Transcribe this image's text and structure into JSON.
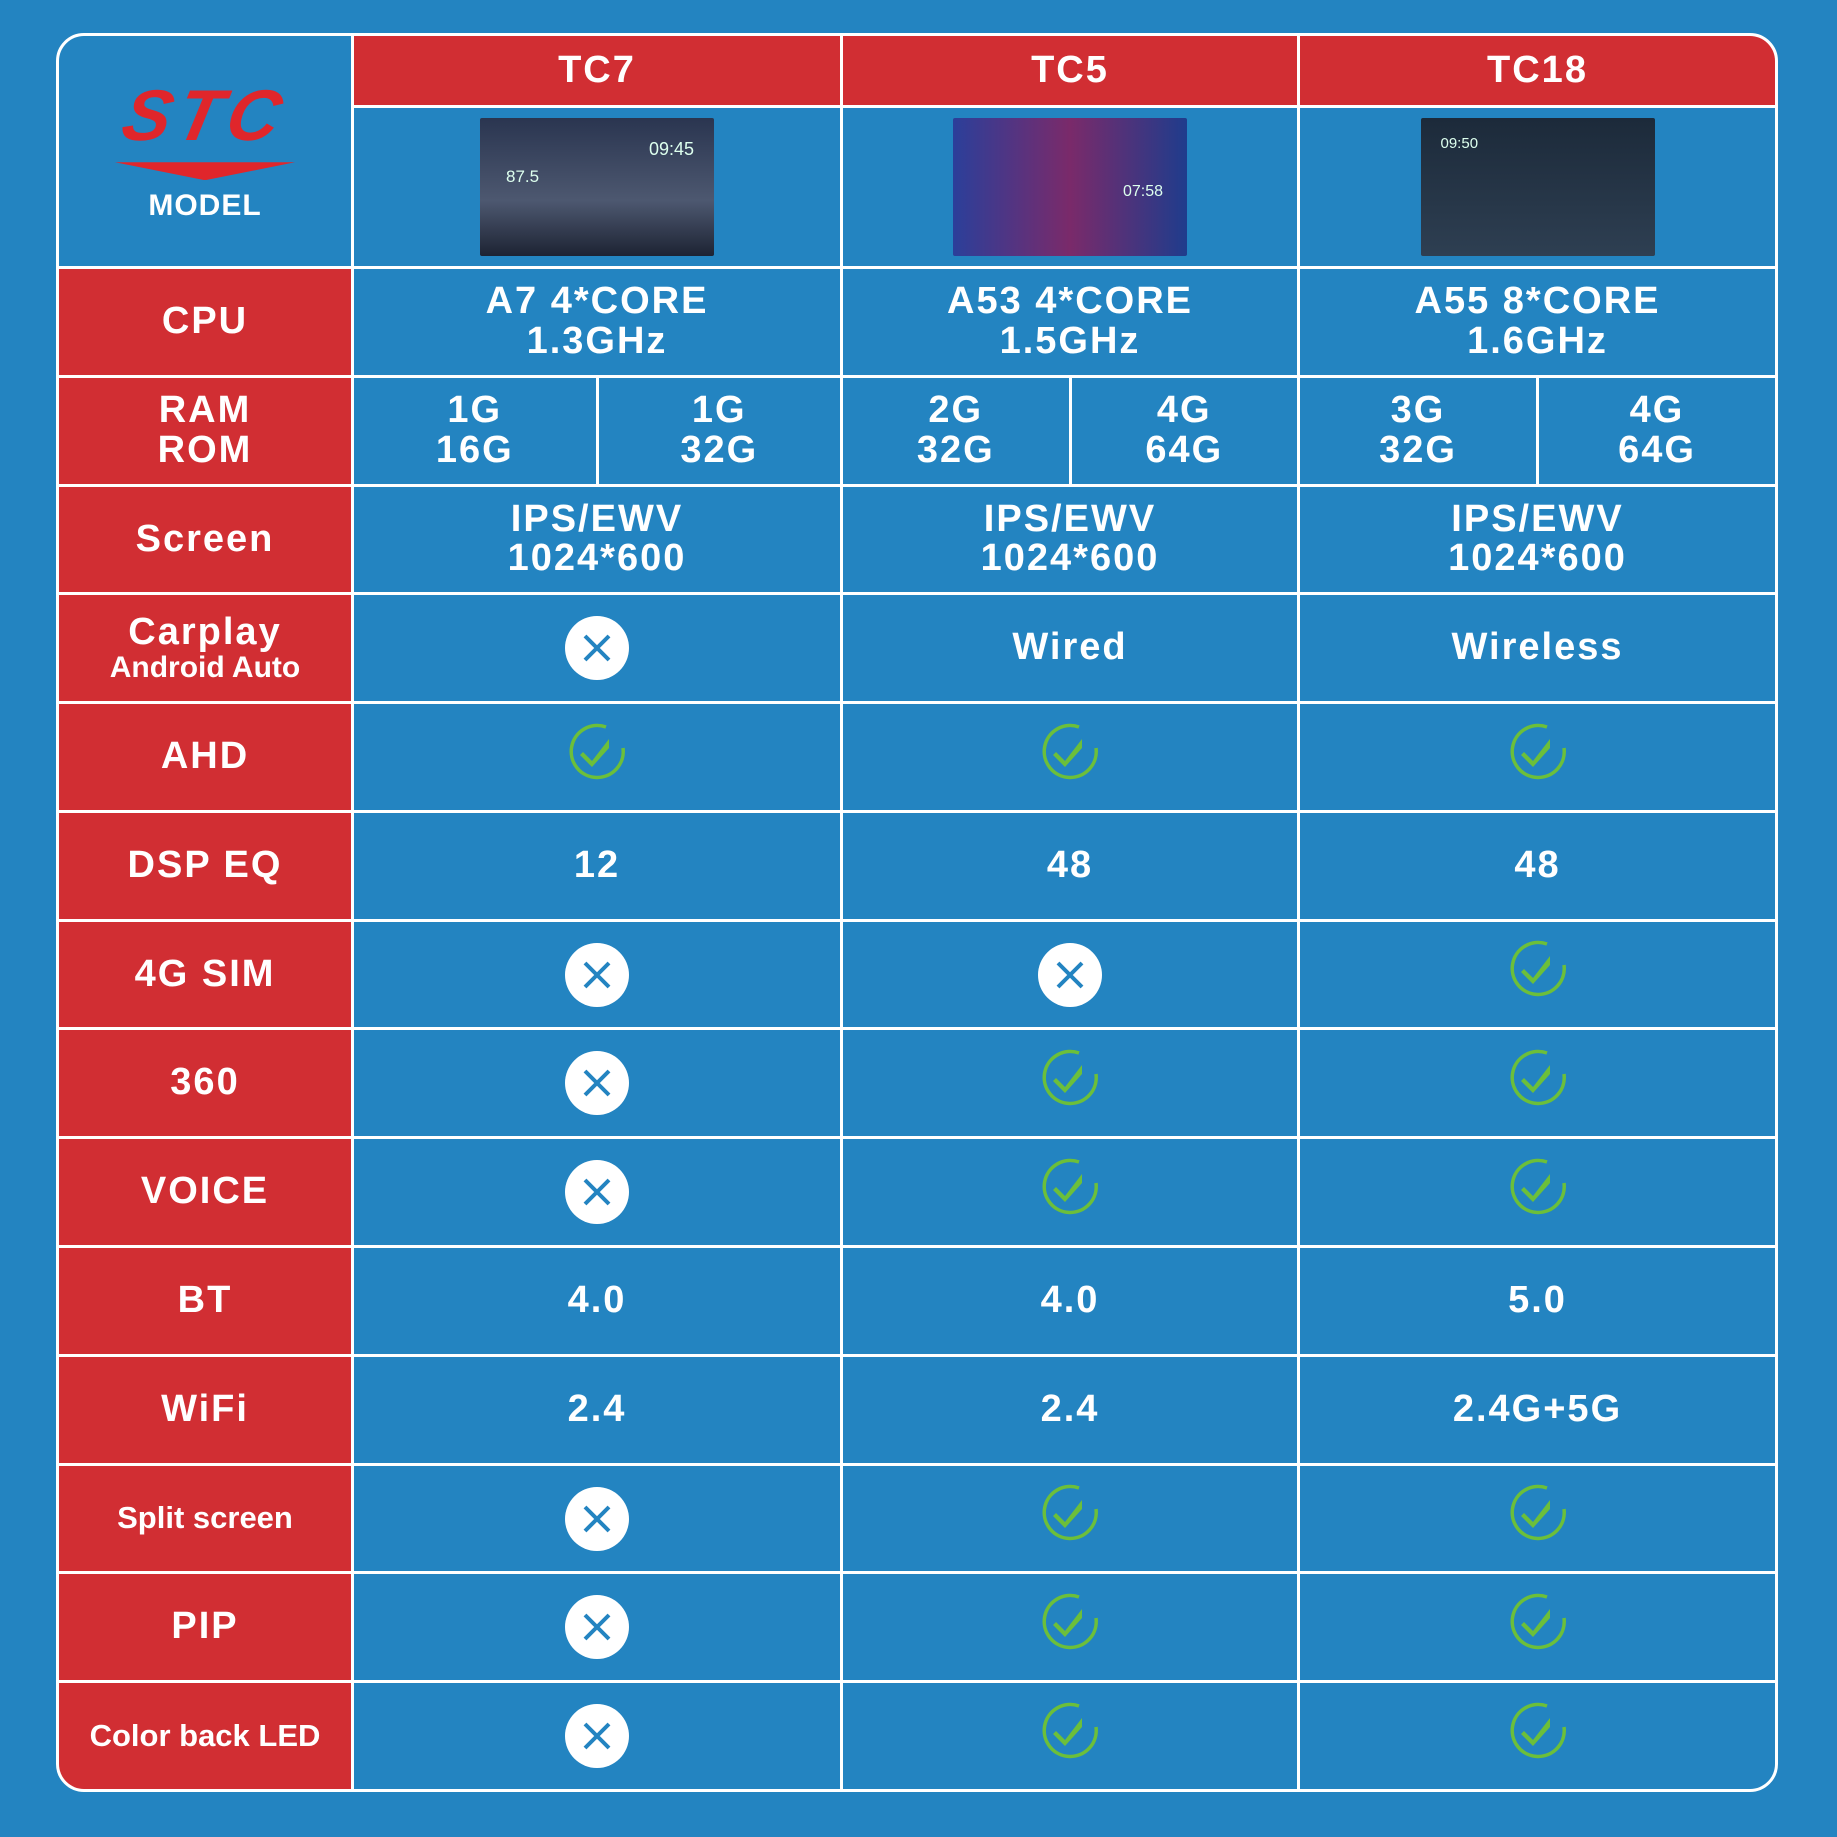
{
  "brand": {
    "logo": "STC",
    "model_label": "MODEL"
  },
  "models": [
    {
      "name": "TC7",
      "screen_time": "09:45",
      "screen_freq": "87.5"
    },
    {
      "name": "TC5",
      "screen_time": "07:58"
    },
    {
      "name": "TC18",
      "screen_time": "09:50"
    }
  ],
  "rows": [
    {
      "label": "CPU",
      "cells": [
        {
          "text": "A7  4*CORE\n1.3GHz"
        },
        {
          "text": "A53  4*CORE\n1.5GHz"
        },
        {
          "text": "A55  8*CORE\n1.6GHz"
        }
      ]
    },
    {
      "label": "RAM\nROM",
      "cells": [
        {
          "split": [
            "1G\n16G",
            "1G\n32G"
          ]
        },
        {
          "split": [
            "2G\n32G",
            "4G\n64G"
          ]
        },
        {
          "split": [
            "3G\n32G",
            "4G\n64G"
          ]
        }
      ]
    },
    {
      "label": "Screen",
      "cells": [
        {
          "text": "IPS/EWV\n1024*600"
        },
        {
          "text": "IPS/EWV\n1024*600"
        },
        {
          "text": "IPS/EWV\n1024*600"
        }
      ]
    },
    {
      "label": "Carplay",
      "sublabel": "Android Auto",
      "cells": [
        {
          "icon": "x"
        },
        {
          "text": "Wired"
        },
        {
          "text": "Wireless"
        }
      ]
    },
    {
      "label": "AHD",
      "cells": [
        {
          "icon": "check"
        },
        {
          "icon": "check"
        },
        {
          "icon": "check"
        }
      ]
    },
    {
      "label": "DSP EQ",
      "cells": [
        {
          "text": "12"
        },
        {
          "text": "48"
        },
        {
          "text": "48"
        }
      ]
    },
    {
      "label": "4G SIM",
      "cells": [
        {
          "icon": "x"
        },
        {
          "icon": "x"
        },
        {
          "icon": "check"
        }
      ]
    },
    {
      "label": "360",
      "cells": [
        {
          "icon": "x"
        },
        {
          "icon": "check"
        },
        {
          "icon": "check"
        }
      ]
    },
    {
      "label": "VOICE",
      "cells": [
        {
          "icon": "x"
        },
        {
          "icon": "check"
        },
        {
          "icon": "check"
        }
      ]
    },
    {
      "label": "BT",
      "cells": [
        {
          "text": "4.0"
        },
        {
          "text": "4.0"
        },
        {
          "text": "5.0"
        }
      ]
    },
    {
      "label": "WiFi",
      "cells": [
        {
          "text": "2.4"
        },
        {
          "text": "2.4"
        },
        {
          "text": "2.4G+5G"
        }
      ]
    },
    {
      "label": "Split screen",
      "cells": [
        {
          "icon": "x"
        },
        {
          "icon": "check"
        },
        {
          "icon": "check"
        }
      ]
    },
    {
      "label": "PIP",
      "cells": [
        {
          "icon": "x"
        },
        {
          "icon": "check"
        },
        {
          "icon": "check"
        }
      ]
    },
    {
      "label": "Color back LED",
      "cells": [
        {
          "icon": "x"
        },
        {
          "icon": "check"
        },
        {
          "icon": "check"
        }
      ]
    }
  ],
  "colors": {
    "background": "#2384c1",
    "header_red": "#d12e33",
    "check_green": "#6cbf3a",
    "x_blue": "#2384c1"
  }
}
